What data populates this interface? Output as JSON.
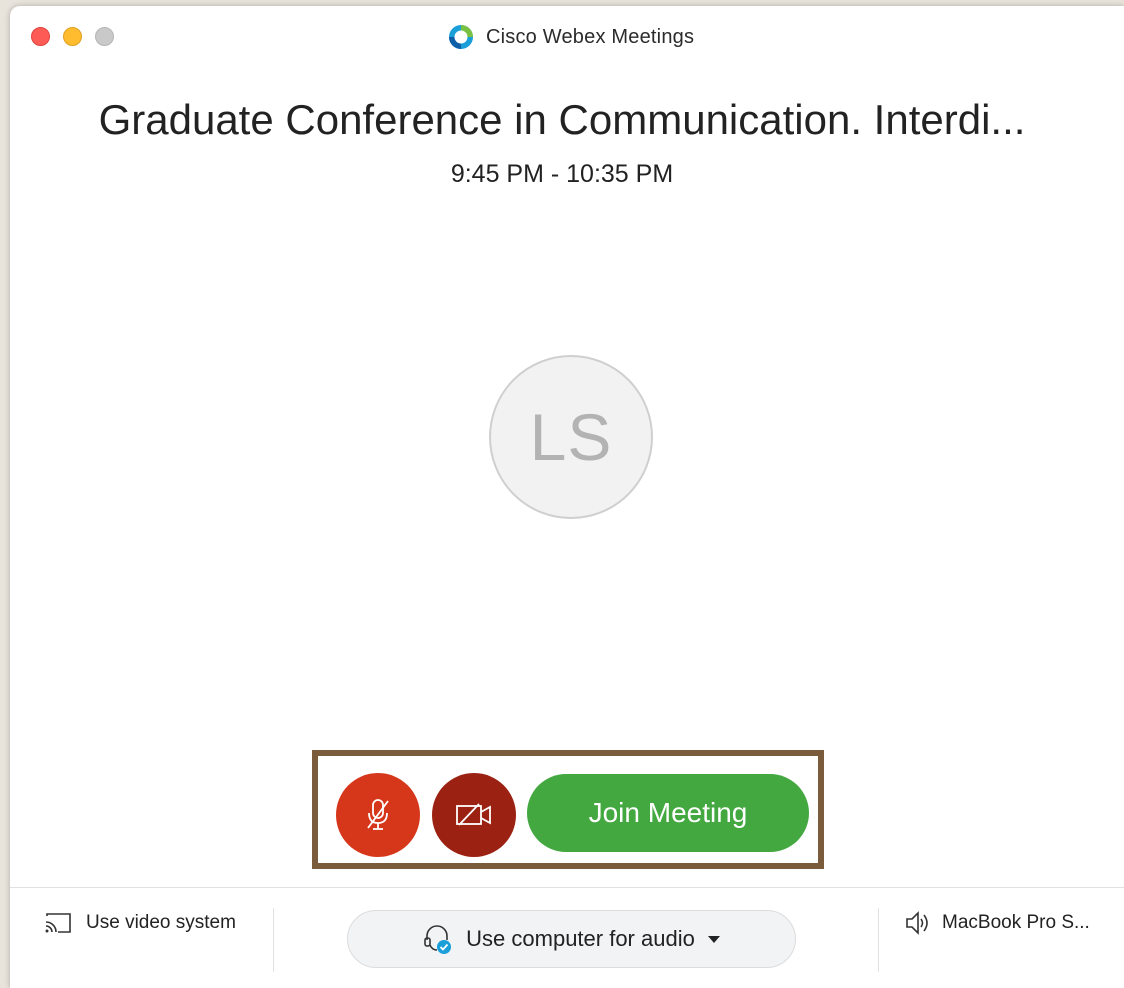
{
  "window": {
    "app_title": "Cisco Webex Meetings"
  },
  "meeting": {
    "title": "Graduate Conference in Communication. Interdi...",
    "time": "9:45 PM - 10:35 PM"
  },
  "avatar": {
    "initials": "LS"
  },
  "controls": {
    "join_label": "Join Meeting",
    "mute_icon": "microphone-muted-icon",
    "video_icon": "camera-off-icon"
  },
  "bottom_bar": {
    "video_system_label": "Use video system",
    "audio_label": "Use computer for audio",
    "speaker_label": "MacBook Pro S..."
  },
  "colors": {
    "mute_button": "#d6371b",
    "video_button": "#9b2212",
    "join_button": "#43a840",
    "highlight_border": "#7a5c3d"
  }
}
